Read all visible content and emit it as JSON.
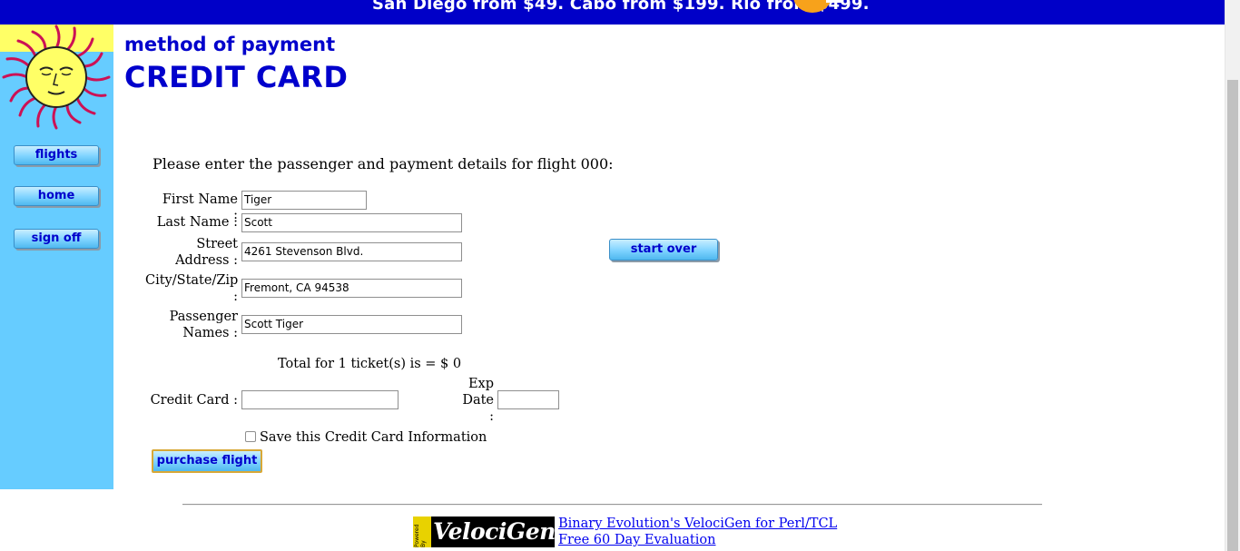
{
  "banner": {
    "text": "San Diego from $49. Cabo from $199. Rio from $499."
  },
  "sidebar": {
    "logo": "sun-logo",
    "items": [
      {
        "label": "flights"
      },
      {
        "label": "home"
      },
      {
        "label": "sign off"
      }
    ]
  },
  "header": {
    "subtitle": "method of payment",
    "title": "CREDIT CARD"
  },
  "form": {
    "intro": "Please enter the passenger and payment details for flight 000:",
    "first_name": {
      "label": "First Name :",
      "value": "Tiger"
    },
    "last_name": {
      "label": "Last Name :",
      "value": "Scott"
    },
    "street": {
      "label_line1": "Street",
      "label_line2": "Address :",
      "value": "4261 Stevenson Blvd."
    },
    "city": {
      "label_line1": "City/State/Zip",
      "label_line2": ":",
      "value": "Fremont, CA 94538"
    },
    "passengers": {
      "label_line1": "Passenger",
      "label_line2": "Names :",
      "value": "Scott Tiger"
    },
    "total": "Total for 1 ticket(s) is = $ 0",
    "credit_card": {
      "label": "Credit Card :",
      "value": ""
    },
    "exp_date": {
      "label_line1": "Exp",
      "label_line2": "Date",
      "label_line3": ":",
      "value": ""
    },
    "save_card": {
      "label": "Save this Credit Card Information",
      "checked": false
    },
    "purchase_label": "purchase flight",
    "start_over_label": "start over"
  },
  "footer": {
    "logo_text": "VelociGen!",
    "powered_text": "Powered By",
    "link1": "Binary Evolution's VelociGen for Perl/TCL",
    "link2": "Free 60 Day Evaluation"
  },
  "colors": {
    "banner": "#0000c8",
    "sidebar": "#66ccff",
    "heading": "#0000cc",
    "link": "#0000ee"
  }
}
